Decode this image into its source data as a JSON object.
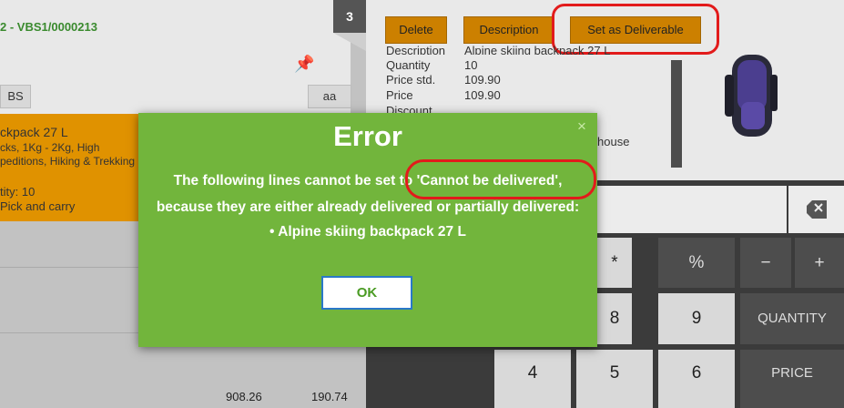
{
  "order": {
    "id": "2 - VBS1/0000213",
    "corner_count": "3",
    "chip_left": "BS",
    "chip_right": "aa",
    "item_name": "ckpack 27 L",
    "item_desc_1": "cks, 1Kg - 2Kg, High",
    "item_desc_2": "peditions, Hiking & Trekking",
    "item_qty": "tity: 10",
    "item_pickup": "Pick and carry",
    "total_a": "908.26",
    "total_b": "190.74"
  },
  "toolbar": {
    "delete_label": "Delete",
    "description_label": "Description",
    "deliverable_label": "Set as Deliverable"
  },
  "detail": {
    "description_label": "Description",
    "description_value": "Alpine skiing backpack 27 L",
    "quantity_label": "Quantity",
    "quantity_value": "10",
    "price_std_label": "Price std.",
    "price_std_value": "109.90",
    "price_label": "Price",
    "price_value": "109.90",
    "discount_label": "Discount",
    "house_text": "house"
  },
  "keypad": {
    "row1": [
      "*",
      "%",
      "−",
      "+"
    ],
    "row2": [
      "8",
      "9",
      "QUANTITY"
    ],
    "row3": [
      "4",
      "5",
      "6",
      "PRICE"
    ]
  },
  "dialog": {
    "title": "Error",
    "close_symbol": "×",
    "line1": "The following lines cannot be set to 'Cannot be delivered',",
    "line2": "because they are either already delivered or partially delivered:",
    "line3": "• Alpine skiing backpack 27 L",
    "ok_label": "OK"
  }
}
